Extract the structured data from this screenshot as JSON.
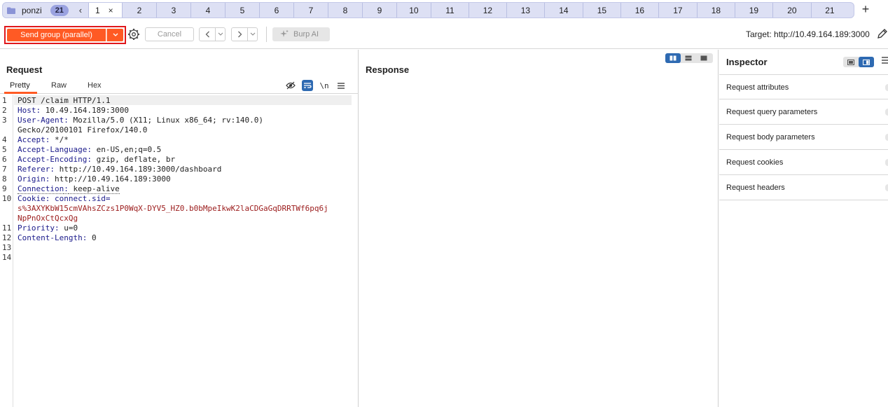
{
  "tab_group": {
    "name": "ponzi",
    "count": "21",
    "prev_glyph": "‹",
    "close_glyph": "×",
    "add_glyph": "+",
    "tabs": [
      "1",
      "2",
      "3",
      "4",
      "5",
      "6",
      "7",
      "8",
      "9",
      "10",
      "11",
      "12",
      "13",
      "14",
      "15",
      "16",
      "17",
      "18",
      "19",
      "20",
      "21"
    ],
    "active_index": 0
  },
  "toolbar": {
    "send_label": "Send group (parallel)",
    "cancel_label": "Cancel",
    "burp_ai_label": "Burp AI",
    "target_label": "Target: http://10.49.164.189:3000"
  },
  "request": {
    "title": "Request",
    "tabs": [
      "Pretty",
      "Raw",
      "Hex"
    ],
    "active_tab": "Pretty",
    "newline_toggle": "\\n",
    "line_numbers": [
      "1",
      "2",
      "3",
      "",
      "4",
      "5",
      "6",
      "7",
      "8",
      "9",
      "10",
      "",
      "",
      "11",
      "12",
      "13",
      "14"
    ],
    "lines": [
      {
        "key": "POST /claim HTTP/1.1",
        "val": ""
      },
      {
        "key": "Host",
        "val": " 10.49.164.189:3000"
      },
      {
        "key": "User-Agent",
        "val": " Mozilla/5.0 (X11; Linux x86_64; rv:140.0)"
      },
      {
        "key": "",
        "val": "Gecko/20100101 Firefox/140.0"
      },
      {
        "key": "Accept",
        "val": " */*"
      },
      {
        "key": "Accept-Language",
        "val": " en-US,en;q=0.5"
      },
      {
        "key": "Accept-Encoding",
        "val": " gzip, deflate, br"
      },
      {
        "key": "Referer",
        "val": " http://10.49.164.189:3000/dashboard"
      },
      {
        "key": "Origin",
        "val": " http://10.49.164.189:3000"
      },
      {
        "key": "Connection",
        "val": " keep-alive"
      },
      {
        "key": "Cookie",
        "val": " connect.sid="
      },
      {
        "key": "",
        "val": "s%3AXYKbW15cmVAhsZCzs1P0WqX-DYV5_HZ0.b0bMpeIkwK2laCDGaGqDRRTWf6pq6j"
      },
      {
        "key": "",
        "val": "NpPnOxCtQcxQg"
      },
      {
        "key": "Priority",
        "val": " u=0"
      },
      {
        "key": "Content-Length",
        "val": " 0"
      },
      {
        "key": "",
        "val": ""
      },
      {
        "key": "",
        "val": ""
      }
    ]
  },
  "response": {
    "title": "Response"
  },
  "inspector": {
    "title": "Inspector",
    "items": [
      "Request attributes",
      "Request query parameters",
      "Request body parameters",
      "Request cookies",
      "Request headers"
    ]
  },
  "colors": {
    "accent": "#ff5a24",
    "highlight_outline": "#e0181c",
    "header_key": "#1a1a8a",
    "cookie_value": "#9b1b1b",
    "tab_group_bg": "#dde0f4",
    "toggle_active": "#2e6ab2"
  }
}
